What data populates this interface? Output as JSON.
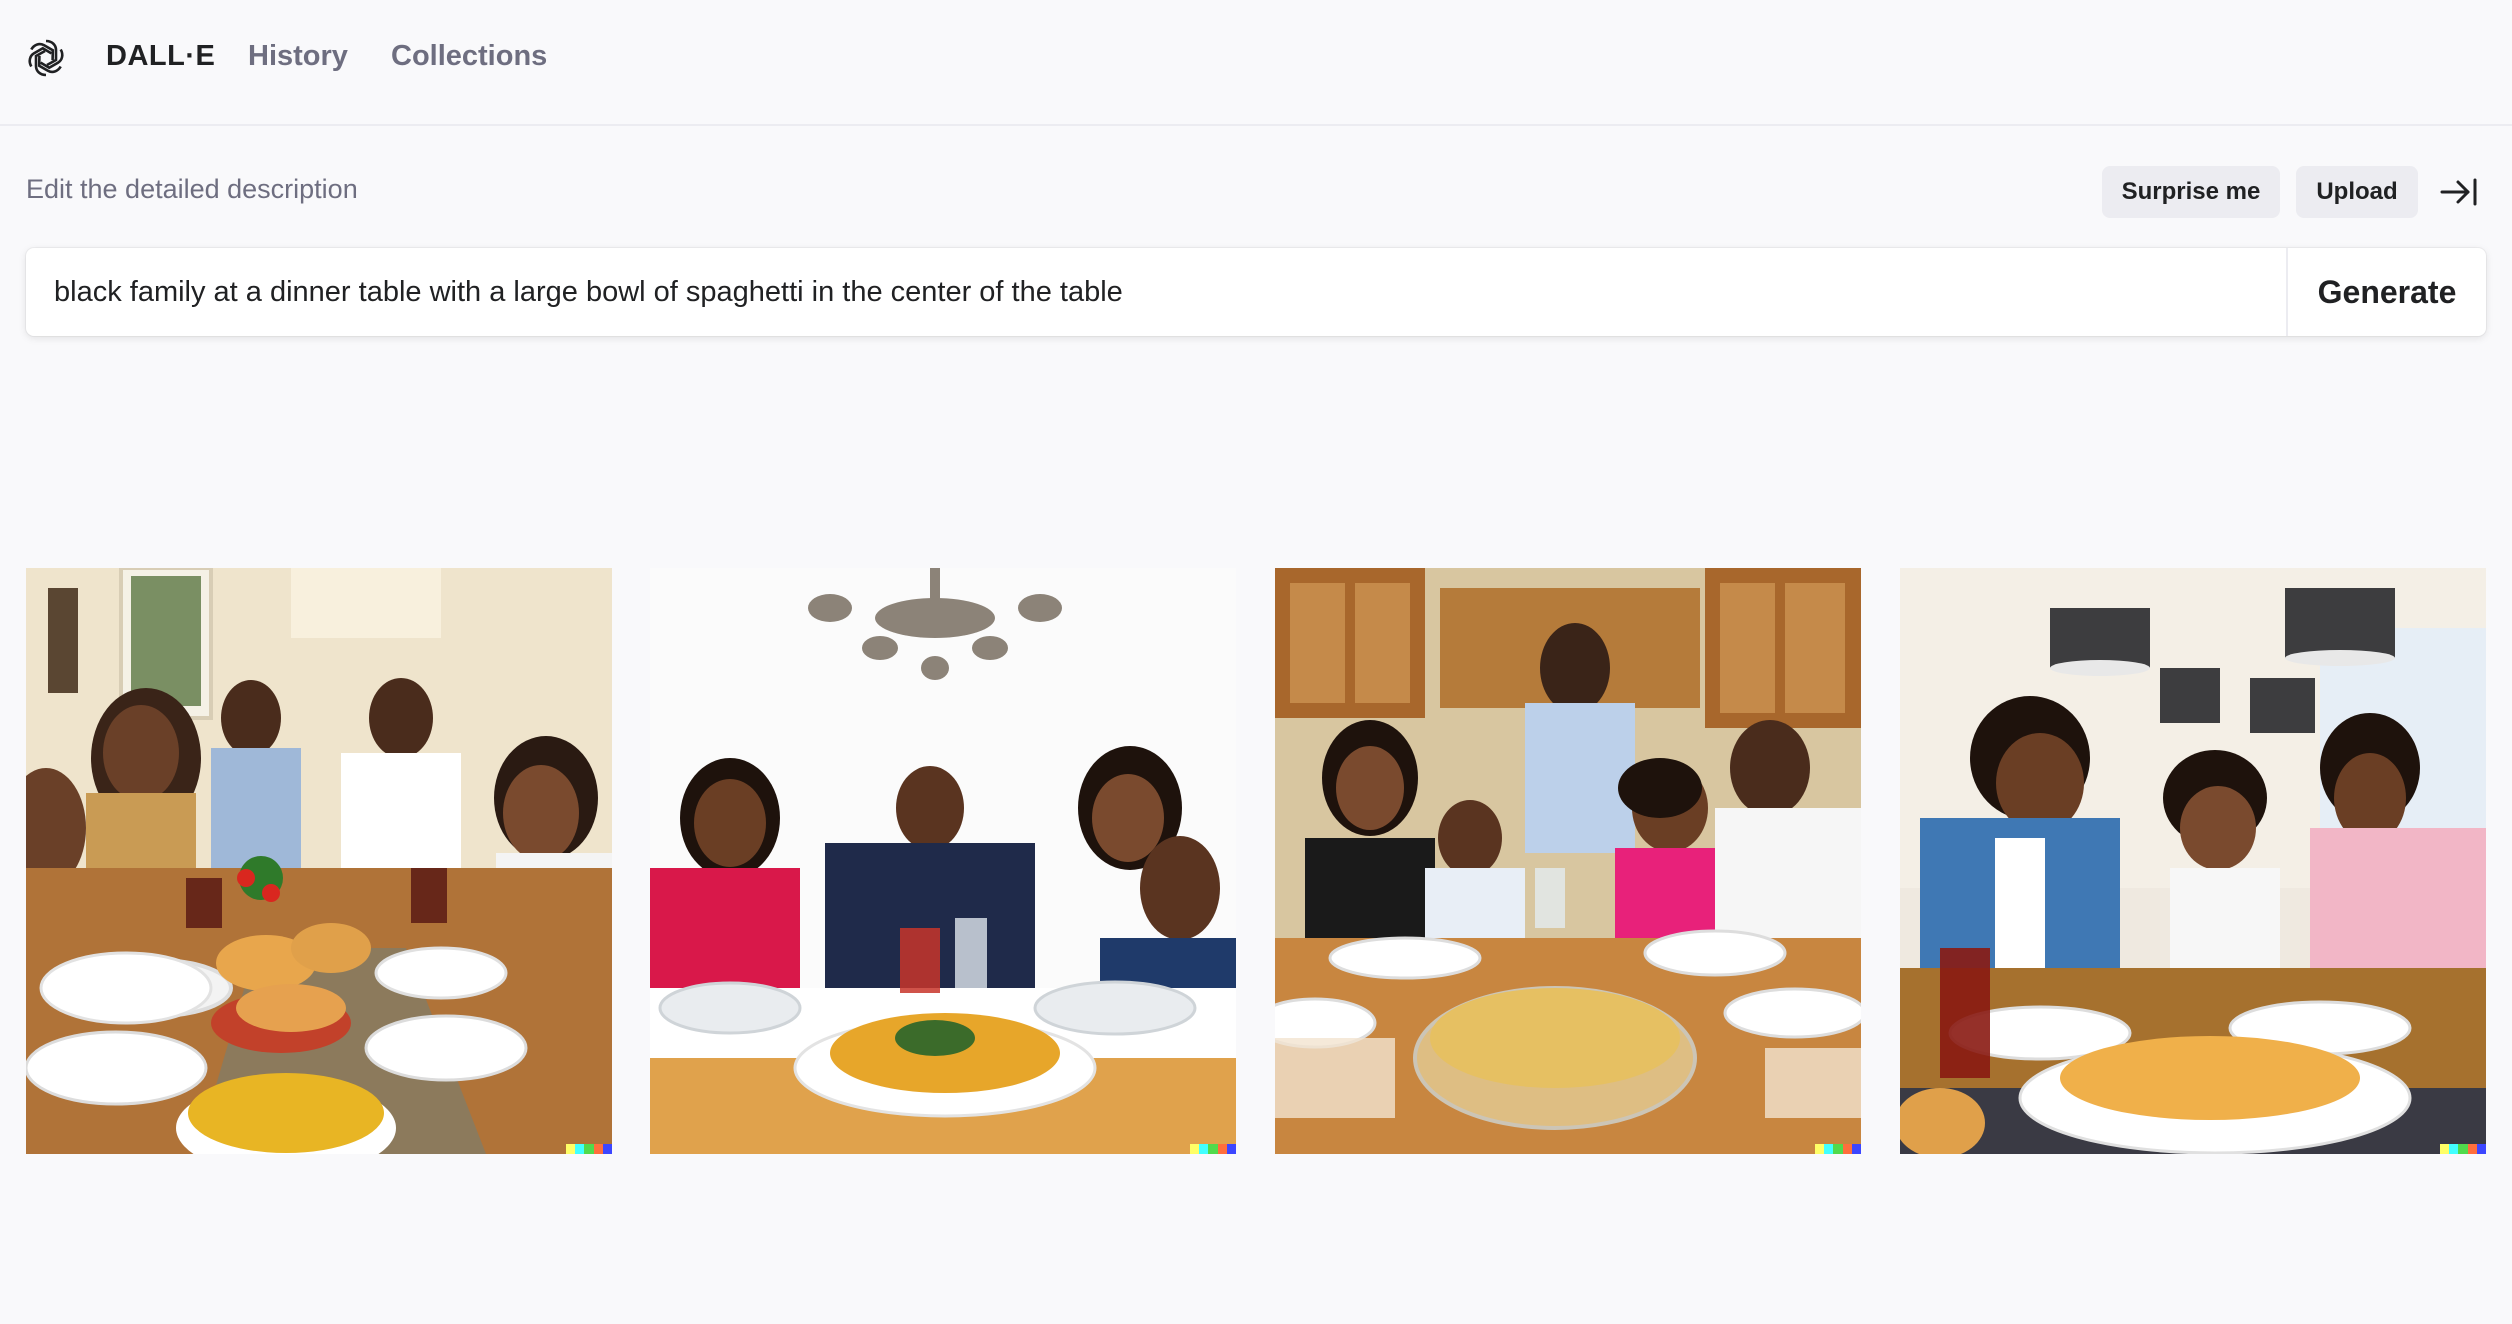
{
  "header": {
    "logo_icon": "openai-logo-icon",
    "brand": "DALL·E",
    "nav": [
      "History",
      "Collections"
    ]
  },
  "editor": {
    "label": "Edit the detailed description",
    "surprise_label": "Surprise me",
    "upload_label": "Upload",
    "collapse_icon": "collapse-right-icon",
    "prompt_value": "black family at a dinner table with a large bowl of spaghetti in the center of the table",
    "generate_label": "Generate"
  },
  "results": {
    "images": [
      {
        "alt": "black family at a dinner table with a large bowl of spaghetti in the center of the table",
        "scene": "dining-room-family-with-bread-and-rice"
      },
      {
        "alt": "black family at a dinner table with a large bowl of spaghetti in the center of the table",
        "scene": "white-room-chandelier-family"
      },
      {
        "alt": "black family at a dinner table with a large bowl of spaghetti in the center of the table",
        "scene": "kitchen-family-glass-bowl"
      },
      {
        "alt": "black family at a dinner table with a large bowl of spaghetti in the center of the table",
        "scene": "pendant-lamps-family-spaghetti-plate"
      }
    ],
    "signature_colors": [
      "#ffff66",
      "#42ffff",
      "#51da4c",
      "#ff6e3c",
      "#3c46ff"
    ]
  },
  "colors": {
    "background": "#f9f9fb",
    "pill_bg": "#ececf1",
    "muted_text": "#6e6e80",
    "text": "#202123"
  }
}
